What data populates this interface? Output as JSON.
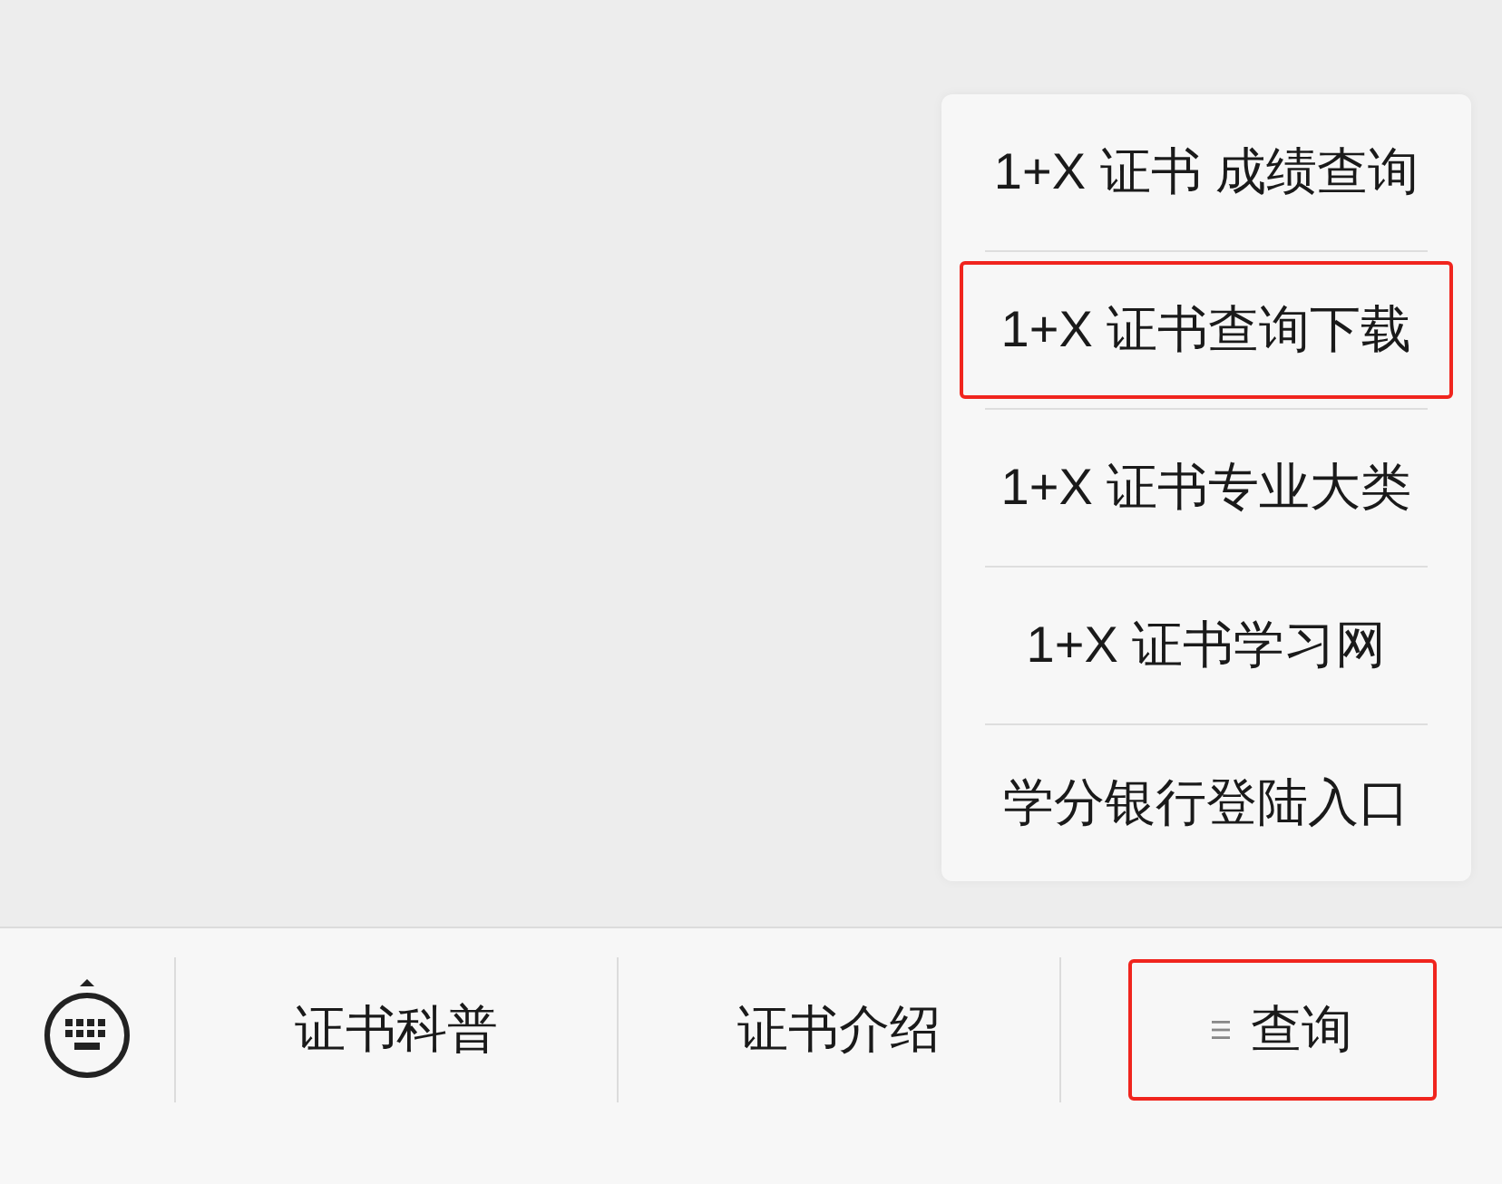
{
  "menu": {
    "items": [
      {
        "label": "1+X 证书 成绩查询",
        "highlighted": false
      },
      {
        "label": "1+X 证书查询下载",
        "highlighted": true
      },
      {
        "label": "1+X 证书专业大类",
        "highlighted": false
      },
      {
        "label": "1+X 证书学习网",
        "highlighted": false
      },
      {
        "label": "学分银行登陆入口",
        "highlighted": false
      }
    ]
  },
  "bottom_bar": {
    "tabs": [
      {
        "label": "证书科普",
        "has_submenu": false,
        "highlighted": false
      },
      {
        "label": "证书介绍",
        "has_submenu": false,
        "highlighted": false
      },
      {
        "label": "查询",
        "has_submenu": true,
        "highlighted": true
      }
    ]
  }
}
